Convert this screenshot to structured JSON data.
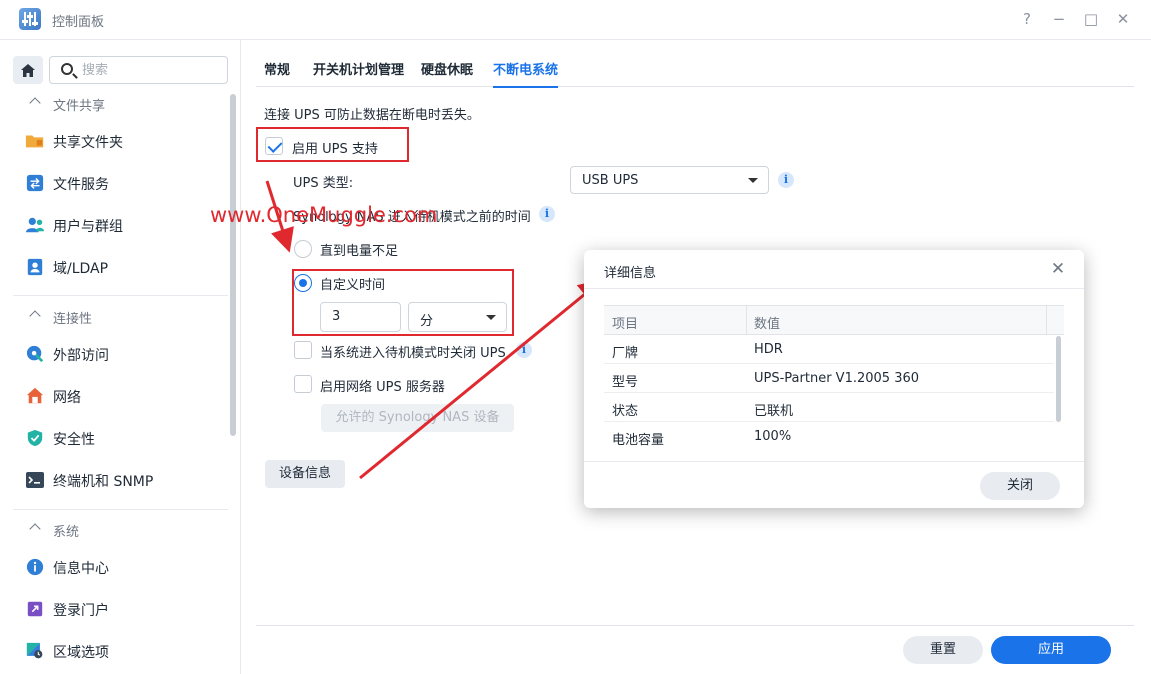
{
  "window": {
    "title": "控制面板",
    "help": "?",
    "minimize": "−",
    "maximize": "□",
    "close": "✕"
  },
  "sidebar": {
    "search_placeholder": "搜索",
    "groups": [
      {
        "label": "文件共享",
        "items": [
          {
            "label": "共享文件夹",
            "icon": "shared-folder-icon"
          },
          {
            "label": "文件服务",
            "icon": "file-services-icon"
          },
          {
            "label": "用户与群组",
            "icon": "users-icon"
          },
          {
            "label": "域/LDAP",
            "icon": "domain-ldap-icon"
          }
        ]
      },
      {
        "label": "连接性",
        "items": [
          {
            "label": "外部访问",
            "icon": "external-access-icon"
          },
          {
            "label": "网络",
            "icon": "network-icon"
          },
          {
            "label": "安全性",
            "icon": "security-shield-icon"
          },
          {
            "label": "终端机和 SNMP",
            "icon": "terminal-icon"
          }
        ]
      },
      {
        "label": "系统",
        "items": [
          {
            "label": "信息中心",
            "icon": "info-center-icon"
          },
          {
            "label": "登录门户",
            "icon": "login-portal-icon"
          },
          {
            "label": "区域选项",
            "icon": "regional-options-icon"
          }
        ]
      }
    ]
  },
  "tabs": [
    "常规",
    "开关机计划管理",
    "硬盘休眠",
    "不断电系统"
  ],
  "active_tab": "不断电系统",
  "ups": {
    "description": "连接 UPS 可防止数据在断电时丢失。",
    "enable_label": "启用 UPS 支持",
    "enable_checked": true,
    "type_label": "UPS 类型:",
    "type_value": "USB UPS",
    "standby_label": "Synology NAS 进入待机模式之前的时间",
    "radio_low_battery": "直到电量不足",
    "radio_custom": "自定义时间",
    "custom_selected": true,
    "time_value": "3",
    "time_unit": "分",
    "shutdown_ups_label": "当系统进入待机模式时关闭 UPS",
    "shutdown_ups_checked": false,
    "network_server_label": "启用网络 UPS 服务器",
    "network_server_checked": false,
    "allowed_devices_button": "允许的 Synology NAS 设备",
    "device_info_button": "设备信息"
  },
  "footer": {
    "reset": "重置",
    "apply": "应用"
  },
  "annotation": {
    "watermark": "www.OneMuggle.com"
  },
  "dialog": {
    "title": "详细信息",
    "columns": [
      "项目",
      "数值"
    ],
    "rows": [
      [
        "厂牌",
        "HDR"
      ],
      [
        "型号",
        "UPS-Partner V1.2005 360"
      ],
      [
        "状态",
        "已联机"
      ],
      [
        "电池容量",
        "100%"
      ]
    ],
    "close_button": "关闭"
  },
  "colors": {
    "accent": "#1a73e8",
    "annotation_red": "#e0292f"
  }
}
